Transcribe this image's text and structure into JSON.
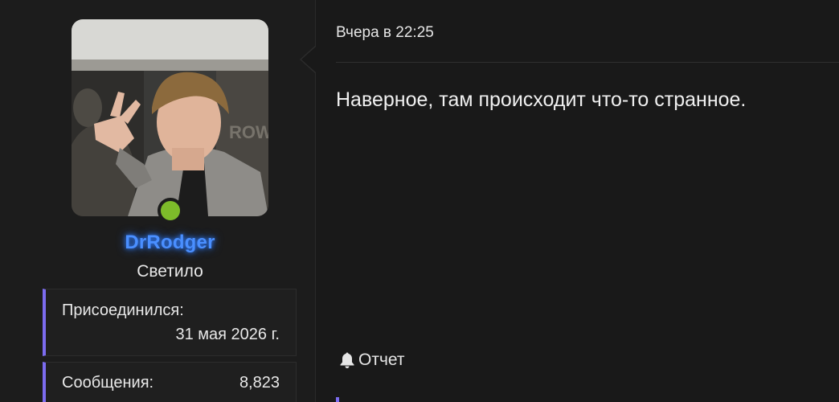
{
  "user": {
    "username": "DrRodger",
    "title": "Светило",
    "online": true,
    "colors": {
      "username": "#4a8fff",
      "online": "#7dbb2a",
      "accent": "#7c6cf0"
    },
    "stats": {
      "joined_label": "Присоединился:",
      "joined_value": "31 мая 2026 г.",
      "messages_label": "Сообщения:",
      "messages_value": "8,823"
    }
  },
  "post": {
    "date": "Вчера в 22:25",
    "text": "Наверное, там происходит что-то странное.",
    "report_label": "Отчет",
    "report_icon": "bell-icon"
  }
}
